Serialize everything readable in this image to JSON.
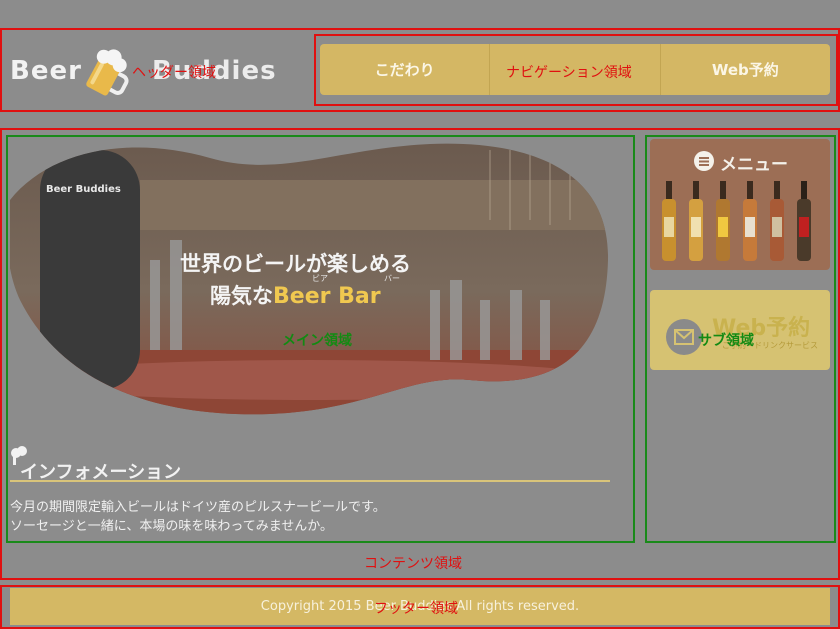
{
  "header": {
    "logo_word1": "Beer",
    "logo_word2": "Buddies",
    "region_label": "ヘッダー領域"
  },
  "nav": {
    "items": [
      "こだわり",
      "",
      "Web予約"
    ],
    "region_label": "ナビゲーション領域"
  },
  "hero": {
    "title_line1": "世界のビールが楽しめる",
    "title_line2_prefix": "陽気な",
    "title_line2_highlight": "Beer Bar",
    "ruby_beer": "ビア",
    "ruby_bar": "バー",
    "brand": "Beer Buddies"
  },
  "main": {
    "region_label": "メイン領域",
    "info_title": "インフォメーション",
    "info_line1": "今月の期間限定輸入ビールはドイツ産のピルスナービールです。",
    "info_line2": "ソーセージと一緒に、本場の味を味わってみませんか。"
  },
  "sub": {
    "region_label": "サブ領域",
    "menu_title": "メニュー",
    "reserve_title": "Web予約",
    "reserve_sub": "ご予約・ドリンクサービス"
  },
  "content": {
    "region_label": "コンテンツ領域"
  },
  "footer": {
    "copyright": "Copyright 2015 Beer Buddies All rights reserved.",
    "region_label": "フッター領域"
  },
  "colors": {
    "background": "#8c8c8c",
    "accent_gold": "#d4b764",
    "region_red": "#e01010",
    "region_green": "#1a8a1a"
  }
}
